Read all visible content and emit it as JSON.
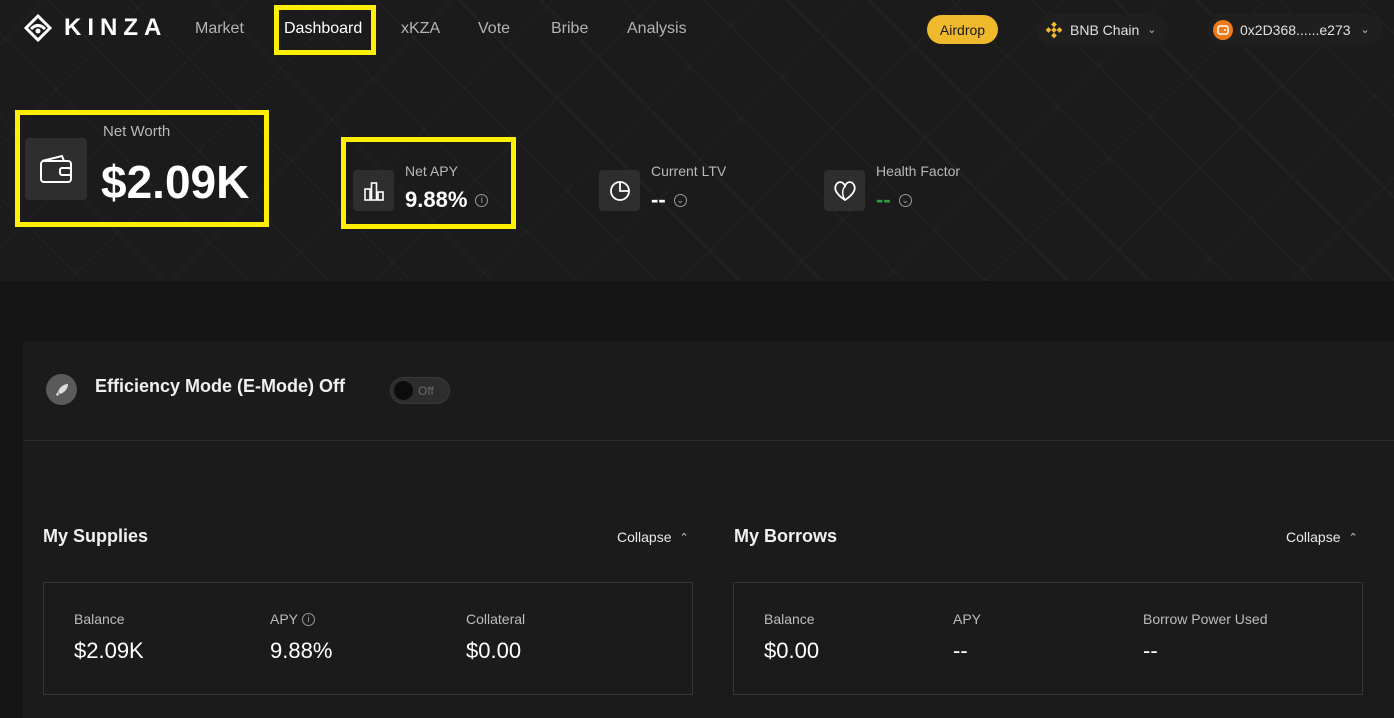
{
  "header": {
    "logo_text": "KINZA",
    "nav": [
      {
        "label": "Market"
      },
      {
        "label": "Dashboard",
        "active": true
      },
      {
        "label": "xKZA"
      },
      {
        "label": "Vote"
      },
      {
        "label": "Bribe"
      },
      {
        "label": "Analysis"
      }
    ],
    "airdrop_label": "Airdrop",
    "chain_label": "BNB Chain",
    "wallet_address": "0x2D368......e273"
  },
  "stats": {
    "net_worth": {
      "label": "Net Worth",
      "value": "$2.09K"
    },
    "net_apy": {
      "label": "Net APY",
      "value": "9.88%"
    },
    "current_ltv": {
      "label": "Current LTV",
      "value": "--"
    },
    "health_factor": {
      "label": "Health Factor",
      "value": "--"
    }
  },
  "emode": {
    "title": "Efficiency Mode (E-Mode) Off",
    "toggle_label": "Off"
  },
  "supplies": {
    "title": "My Supplies",
    "collapse_label": "Collapse",
    "balance": {
      "label": "Balance",
      "value": "$2.09K"
    },
    "apy": {
      "label": "APY",
      "value": "9.88%"
    },
    "collateral": {
      "label": "Collateral",
      "value": "$0.00"
    }
  },
  "borrows": {
    "title": "My Borrows",
    "collapse_label": "Collapse",
    "balance": {
      "label": "Balance",
      "value": "$0.00"
    },
    "apy": {
      "label": "APY",
      "value": "--"
    },
    "borrow_power": {
      "label": "Borrow Power Used",
      "value": "--"
    }
  },
  "colors": {
    "accent_highlight": "#ffef00",
    "airdrop_bg": "#efb92d",
    "health_dash": "#2ea043",
    "bnb_yellow": "#f3ba2f",
    "wallet_orange": "#f07a1a"
  },
  "icons": [
    "kinza-logo-icon",
    "bnb-icon",
    "wallet-avatar-icon",
    "wallet-icon",
    "bar-chart-icon",
    "pie-chart-icon",
    "heart-icon",
    "rocket-icon",
    "info-icon",
    "chevron-down-icon",
    "chevron-up-icon"
  ]
}
